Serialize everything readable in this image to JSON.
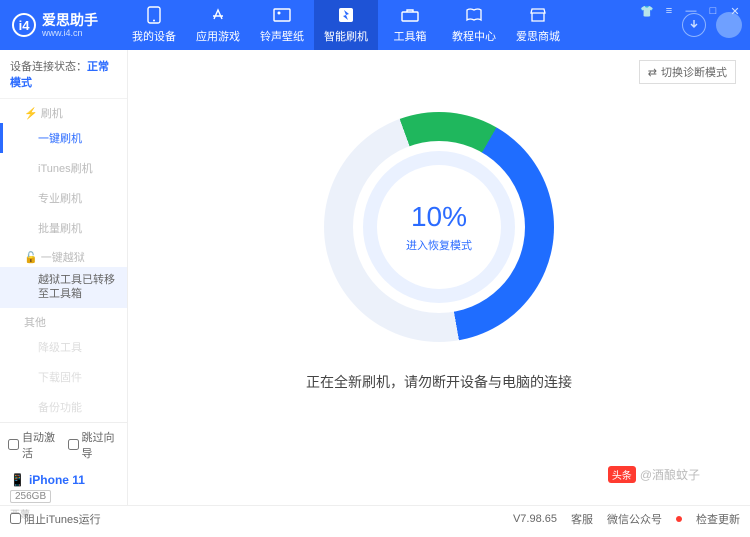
{
  "brand": {
    "name": "爱思助手",
    "site": "www.i4.cn",
    "badge": "i4"
  },
  "nav": [
    {
      "label": "我的设备"
    },
    {
      "label": "应用游戏"
    },
    {
      "label": "铃声壁纸"
    },
    {
      "label": "智能刷机"
    },
    {
      "label": "工具箱"
    },
    {
      "label": "教程中心"
    },
    {
      "label": "爱思商城"
    }
  ],
  "status": {
    "label": "设备连接状态：",
    "value": "正常模式"
  },
  "sidebar": {
    "group1": "刷机",
    "items1": [
      "一键刷机",
      "iTunes刷机",
      "专业刷机",
      "批量刷机"
    ],
    "group2": "一键越狱",
    "jailbreak_note": "越狱工具已转移至工具箱",
    "items3": [
      "其他",
      "降级工具",
      "下载固件",
      "备份功能"
    ],
    "checks": {
      "auto_activate": "自动激活",
      "skip_guide": "跳过向导"
    },
    "device": {
      "name": "iPhone 11",
      "capacity": "256GB",
      "loc": "西蒙"
    }
  },
  "main": {
    "mode_btn": "切换诊断模式",
    "percent": "10%",
    "percent_sub": "进入恢复模式",
    "message": "正在全新刷机，请勿断开设备与电脑的连接"
  },
  "footer": {
    "block_itunes": "阻止iTunes运行",
    "version": "V7.98.65",
    "links": [
      "客服",
      "微信公众号",
      "检查更新"
    ]
  },
  "watermark": {
    "badge": "头条",
    "text": "@酒酿蚊子"
  }
}
